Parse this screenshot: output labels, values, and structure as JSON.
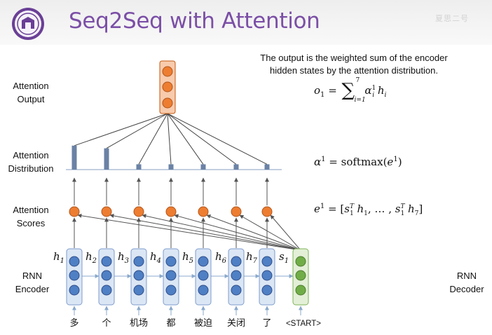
{
  "title": "Seq2Seq with Attention",
  "watermark": "夏思二号",
  "labels": {
    "attention_output": [
      "Attention",
      "Output"
    ],
    "attention_distribution": [
      "Attention",
      "Distribution"
    ],
    "attention_scores": [
      "Attention",
      "Scores"
    ],
    "rnn_encoder": [
      "RNN",
      "Encoder"
    ],
    "rnn_decoder": [
      "RNN",
      "Decoder"
    ]
  },
  "caption": [
    "The output is the weighted sum of the encoder",
    "hidden states by the attention distribution."
  ],
  "equations": {
    "output": "o₁ = Σᵢ₌₁⁷ αᵢ¹ hᵢ",
    "distribution": "α¹ = softmax(e¹)",
    "scores": "e¹ = [s₁ᵀh₁, …, s₁ᵀh₇]"
  },
  "encoder_words": [
    "多",
    "个",
    "机场",
    "都",
    "被迫",
    "关闭",
    "了"
  ],
  "decoder_word": "<START>",
  "hidden_labels": [
    "h1",
    "h2",
    "h3",
    "h4",
    "h5",
    "h6",
    "h7"
  ],
  "decoder_state_label": "s1",
  "attention_weights": [
    0.9,
    0.8,
    0.2,
    0.2,
    0.2,
    0.2,
    0.2
  ],
  "colors": {
    "title": "#7b4fa6",
    "encoder_cell_fill": "#dbe6f5",
    "encoder_node": "#4f7fc4",
    "decoder_cell_fill": "#e3efd6",
    "decoder_node": "#70ad47",
    "score_node": "#ed7d31",
    "output_cell_fill": "#f8cbad",
    "bar": "#6b82a5",
    "arrow": "#555555",
    "rnn_arrow": "#8aa9cc"
  },
  "icons": {
    "logo": "university-seal-icon"
  }
}
